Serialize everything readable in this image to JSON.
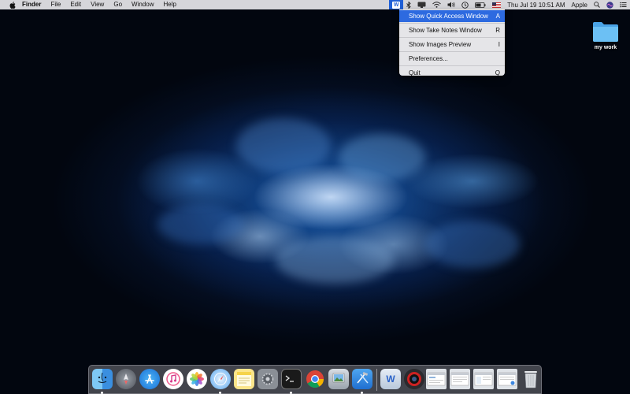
{
  "menubar": {
    "app_name": "Finder",
    "menus": [
      "File",
      "Edit",
      "View",
      "Go",
      "Window",
      "Help"
    ],
    "status": {
      "app_badge": "W",
      "clock": "Thu Jul 19  10:51 AM",
      "user": "Apple"
    }
  },
  "dropdown": {
    "items": [
      {
        "label": "Show Quick Access Window",
        "shortcut": "A"
      },
      {
        "label": "Show Take Notes Window",
        "shortcut": "R"
      },
      {
        "label": "Show Images Preview",
        "shortcut": "I"
      },
      {
        "label": "Preferences...",
        "shortcut": ""
      },
      {
        "label": "Quit",
        "shortcut": "Q"
      }
    ]
  },
  "desktop": {
    "folder_label": "my work"
  },
  "dock": {
    "badge_w": "W",
    "apps": [
      "finder-icon",
      "launchpad-icon",
      "app-store-icon",
      "itunes-icon",
      "photos-icon",
      "safari-icon",
      "notes-icon",
      "system-preferences-icon",
      "terminal-icon",
      "chrome-icon",
      "preview-icon",
      "xcode-icon",
      "writing-app-icon",
      "photo-booth-icon",
      "window-1-icon",
      "window-2-icon",
      "window-3-icon",
      "window-4-icon",
      "trash-icon"
    ]
  },
  "colors": {
    "highlight": "#2d6ae0",
    "menubar": "#e8e8ec",
    "folder": "#5fb6ef"
  }
}
